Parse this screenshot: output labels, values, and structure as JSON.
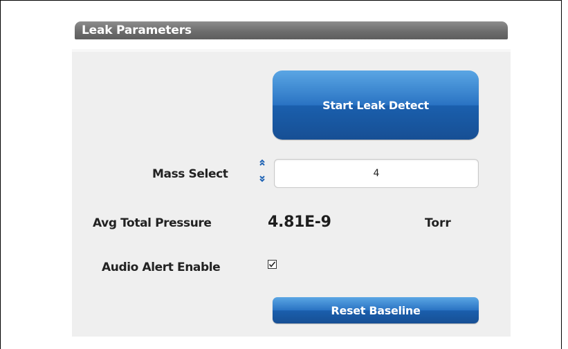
{
  "panel": {
    "title": "Leak Parameters"
  },
  "controls": {
    "start_button_label": "Start Leak Detect",
    "mass_select_label": "Mass Select",
    "mass_select_value": "4",
    "avg_pressure_label": "Avg Total Pressure",
    "avg_pressure_value": "4.81E-9",
    "avg_pressure_unit": "Torr",
    "audio_alert_label": "Audio Alert Enable",
    "audio_alert_checked": true,
    "reset_button_label": "Reset Baseline"
  },
  "icons": {
    "spinner_up": "chevron-double-up-icon",
    "spinner_down": "chevron-double-down-icon",
    "checkbox": "checkmark-icon"
  },
  "colors": {
    "header_bg": "#6d6d6d",
    "button_blue": "#2a73c3",
    "panel_bg": "#efefef",
    "spinner_blue": "#1f63b4"
  }
}
